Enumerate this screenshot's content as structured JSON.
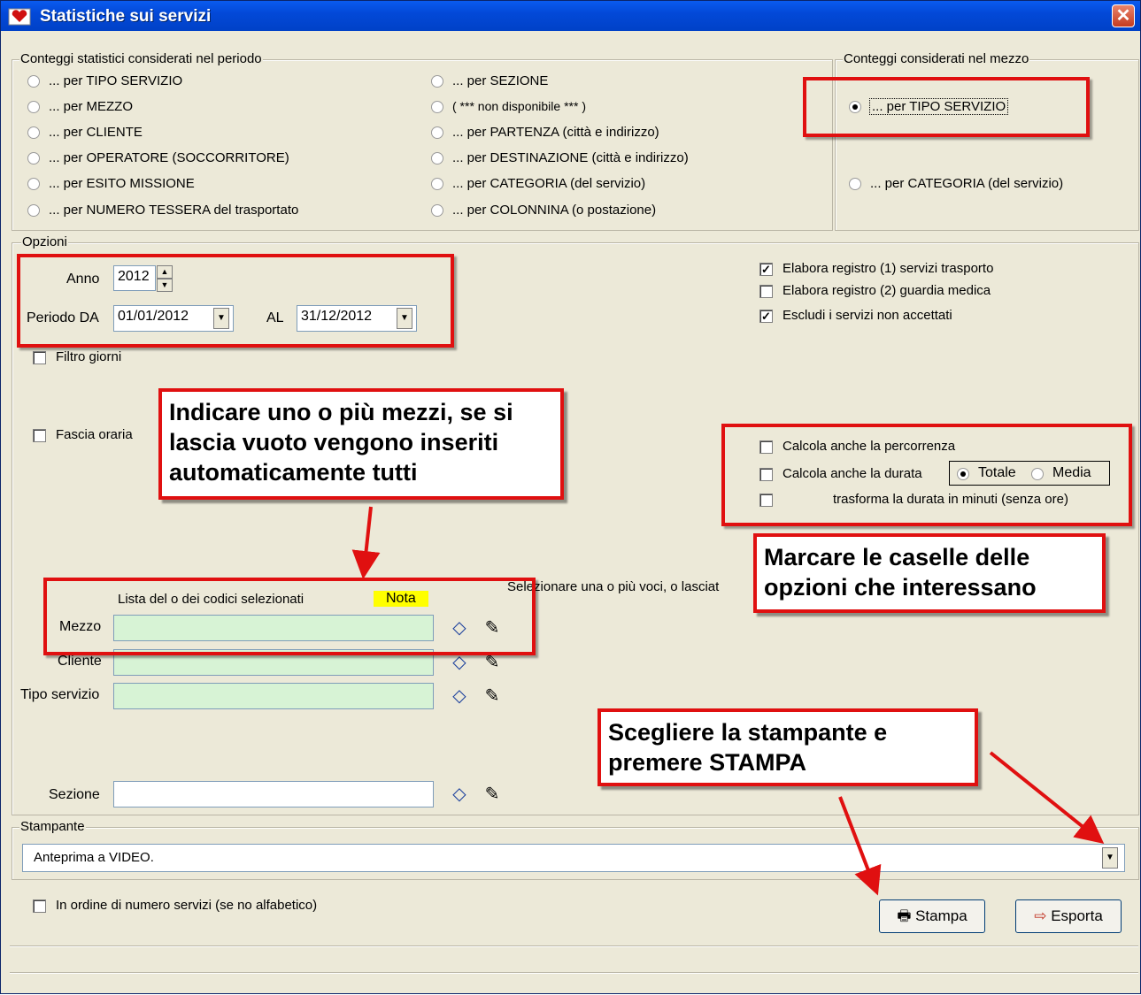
{
  "window": {
    "title": "Statistiche sui servizi",
    "close": "✕"
  },
  "period_group": {
    "legend": "Conteggi statistici considerati nel periodo",
    "col1": [
      "... per TIPO SERVIZIO",
      "... per MEZZO",
      "... per CLIENTE",
      "... per OPERATORE (SOCCORRITORE)",
      "... per ESITO MISSIONE",
      "... per NUMERO TESSERA del trasportato"
    ],
    "col2": [
      "... per SEZIONE",
      "( *** non disponibile *** )",
      "... per PARTENZA (città e indirizzo)",
      "... per DESTINAZIONE (città e indirizzo)",
      "... per CATEGORIA (del servizio)",
      "... per COLONNINA (o postazione)"
    ]
  },
  "mezzo_group": {
    "legend": "Conteggi considerati nel mezzo",
    "opt1": "... per TIPO SERVIZIO",
    "opt2": "... per CATEGORIA (del servizio)"
  },
  "options": {
    "legend": "Opzioni",
    "anno_label": "Anno",
    "anno_value": "2012",
    "periodo_label": "Periodo DA",
    "da_value": "01/01/2012",
    "al_label": "AL",
    "al_value": "31/12/2012",
    "filtro_giorni": "Filtro giorni",
    "fascia_oraria": "Fascia oraria",
    "reg1": "Elabora registro (1) servizi trasporto",
    "reg2": "Elabora registro (2) guardia medica",
    "escludi": "Escludi i servizi non accettati",
    "percorrenza": "Calcola anche la percorrenza",
    "durata": "Calcola anche la durata",
    "totale": "Totale",
    "media": "Media",
    "trasforma": "trasforma la durata in minuti (senza ore)"
  },
  "codes": {
    "lista_label": "Lista del o dei codici selezionati",
    "nota": "Nota",
    "hint": "Selezionare una o più voci, o lasciat",
    "mezzo": "Mezzo",
    "cliente": "Cliente",
    "tipo": "Tipo servizio",
    "sezione": "Sezione"
  },
  "printer": {
    "legend": "Stampante",
    "value": "Anteprima a VIDEO.",
    "ordine": "In ordine di numero servizi (se no alfabetico)",
    "stampa": "Stampa",
    "esporta": "Esporta"
  },
  "annotations": {
    "mezzi": "Indicare uno o più mezzi, se si lascia vuoto vengono inseriti automaticamente tutti",
    "caselle": "Marcare le caselle delle opzioni che interessano",
    "stampa": "Scegliere la stampante e premere STAMPA"
  },
  "accent": {
    "red": "#E01010",
    "titlebar": "#0349D8",
    "nota_bg": "#FFFF00",
    "field_green": "#D7F3D5"
  }
}
